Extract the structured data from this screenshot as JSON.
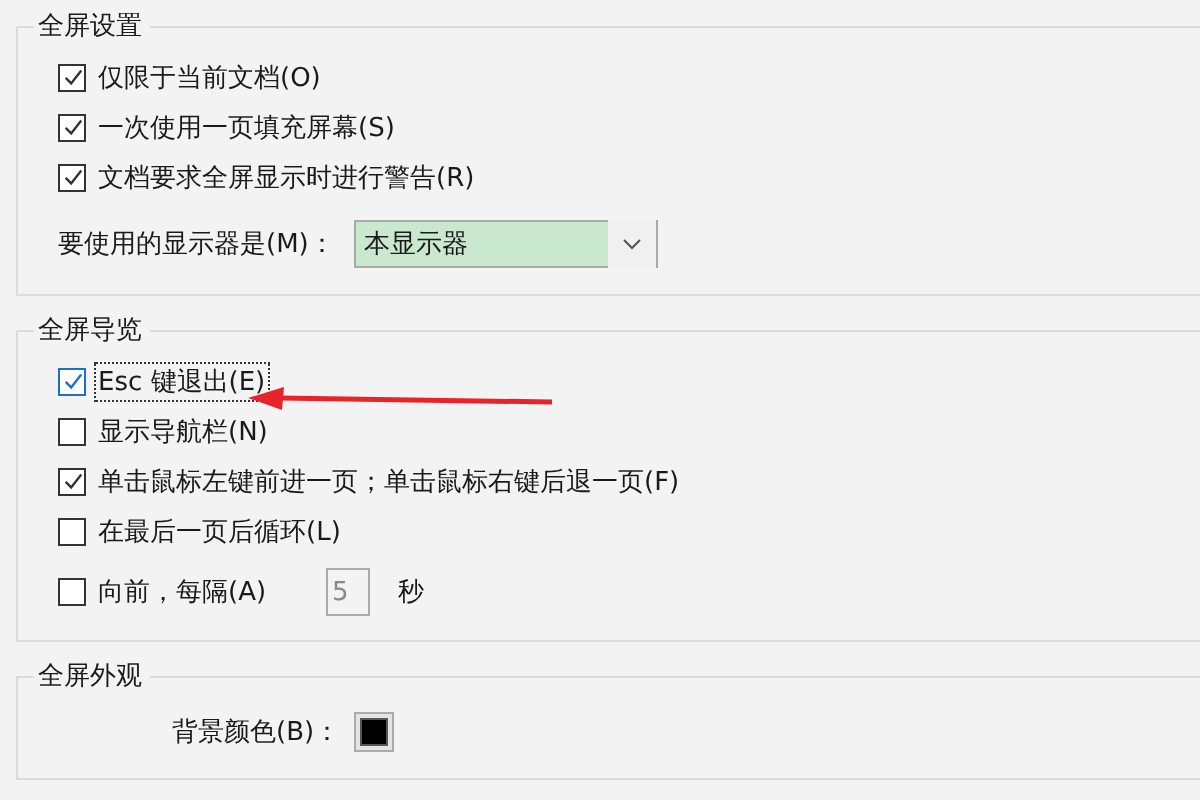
{
  "sections": [
    {
      "title": "全屏设置",
      "items": [
        {
          "kind": "checkbox",
          "label": "仅限于当前文档(O)",
          "checked": true,
          "focused": false
        },
        {
          "kind": "checkbox",
          "label": "一次使用一页填充屏幕(S)",
          "checked": true,
          "focused": false
        },
        {
          "kind": "checkbox",
          "label": "文档要求全屏显示时进行警告(R)",
          "checked": true,
          "focused": false
        },
        {
          "kind": "dropdown",
          "label": "要使用的显示器是(M)：",
          "value": "本显示器"
        }
      ]
    },
    {
      "title": "全屏导览",
      "items": [
        {
          "kind": "checkbox",
          "label": "Esc 键退出(E)",
          "checked": true,
          "focused": true
        },
        {
          "kind": "checkbox",
          "label": "显示导航栏(N)",
          "checked": false,
          "focused": false
        },
        {
          "kind": "checkbox",
          "label": "单击鼠标左键前进一页；单击鼠标右键后退一页(F)",
          "checked": true,
          "focused": false
        },
        {
          "kind": "checkbox",
          "label": "在最后一页后循环(L)",
          "checked": false,
          "focused": false
        },
        {
          "kind": "interval",
          "label": "向前，每隔(A)",
          "checked": false,
          "value": "5",
          "unit": "秒",
          "disabled": true
        }
      ]
    },
    {
      "title": "全屏外观",
      "items": [
        {
          "kind": "color",
          "label": "背景颜色(B)：",
          "color": "#000000"
        }
      ]
    }
  ]
}
